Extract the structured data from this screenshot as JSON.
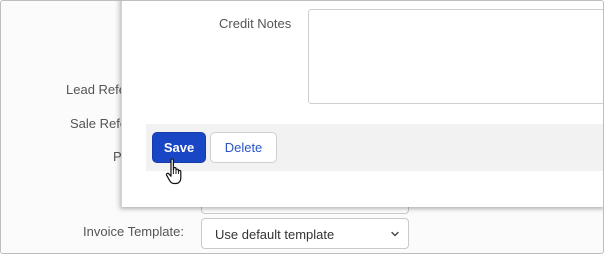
{
  "background_form": {
    "labels": {
      "lead_referral": "Lead Refe",
      "sale_referral": "Sale Refe",
      "p_partial": "P",
      "invoice_template": "Invoice Template:"
    },
    "invoice_template_select": {
      "value": "Use default template",
      "icon": "chevron-down-icon"
    }
  },
  "modal": {
    "credit_notes_label": "Credit Notes",
    "credit_notes_value": "",
    "buttons": {
      "save": "Save",
      "delete": "Delete"
    }
  },
  "colors": {
    "primary": "#1946c4",
    "link": "#2a55c8",
    "footer_bg": "#f2f2f2"
  },
  "cursor": "hand-pointer-icon"
}
